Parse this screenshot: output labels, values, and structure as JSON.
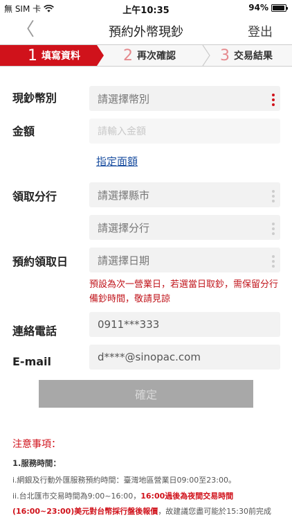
{
  "status_bar": {
    "carrier": "無 SIM 卡",
    "time": "上午10:35",
    "battery_text": "94%",
    "battery_level": 0.94,
    "icons": [
      "wifi-icon",
      "battery-icon"
    ]
  },
  "nav": {
    "back_glyph": "〈",
    "title": "預約外幣現鈔",
    "logout": "登出"
  },
  "steps": [
    {
      "num": "1",
      "label": "填寫資料",
      "active": true
    },
    {
      "num": "2",
      "label": "再次確認",
      "active": false
    },
    {
      "num": "3",
      "label": "交易結果",
      "active": false
    }
  ],
  "form": {
    "currency_label": "現鈔幣別",
    "currency_placeholder": "請選擇幣別",
    "amount_label": "金額",
    "amount_placeholder": "請輸入金額",
    "denomination_link": "指定面額",
    "branch_label": "領取分行",
    "county_placeholder": "請選擇縣市",
    "branch_placeholder": "請選擇分行",
    "date_label": "預約領取日",
    "date_placeholder": "請選擇日期",
    "date_warning": "預設為次一營業日，若選當日取鈔，需保留分行備鈔時間，敬請見諒",
    "phone_label": "連絡電話",
    "phone_value": "0911***333",
    "email_label": "E-mail",
    "email_value": "d****@sinopac.com",
    "confirm_label": "確定"
  },
  "notes": {
    "title": "注意事項：",
    "heading": "1.服務時間：",
    "line1": "i.網銀及行動外匯服務預約時間：臺灣地區營業日09:00至23:00。",
    "line2_a": "ii.台北匯市交易時間為9:00~16:00，",
    "line2_b": "16:00過後為夜間交易時間",
    "line3_a": "(16:00~23:00)美元對台幣採行盤後報價",
    "line3_b": "，故建議您盡可能於15:30前完成"
  },
  "colors": {
    "brand_red": "#d0121b",
    "link_blue": "#1a4ea0",
    "button_disabled": "#a8a8a8"
  }
}
